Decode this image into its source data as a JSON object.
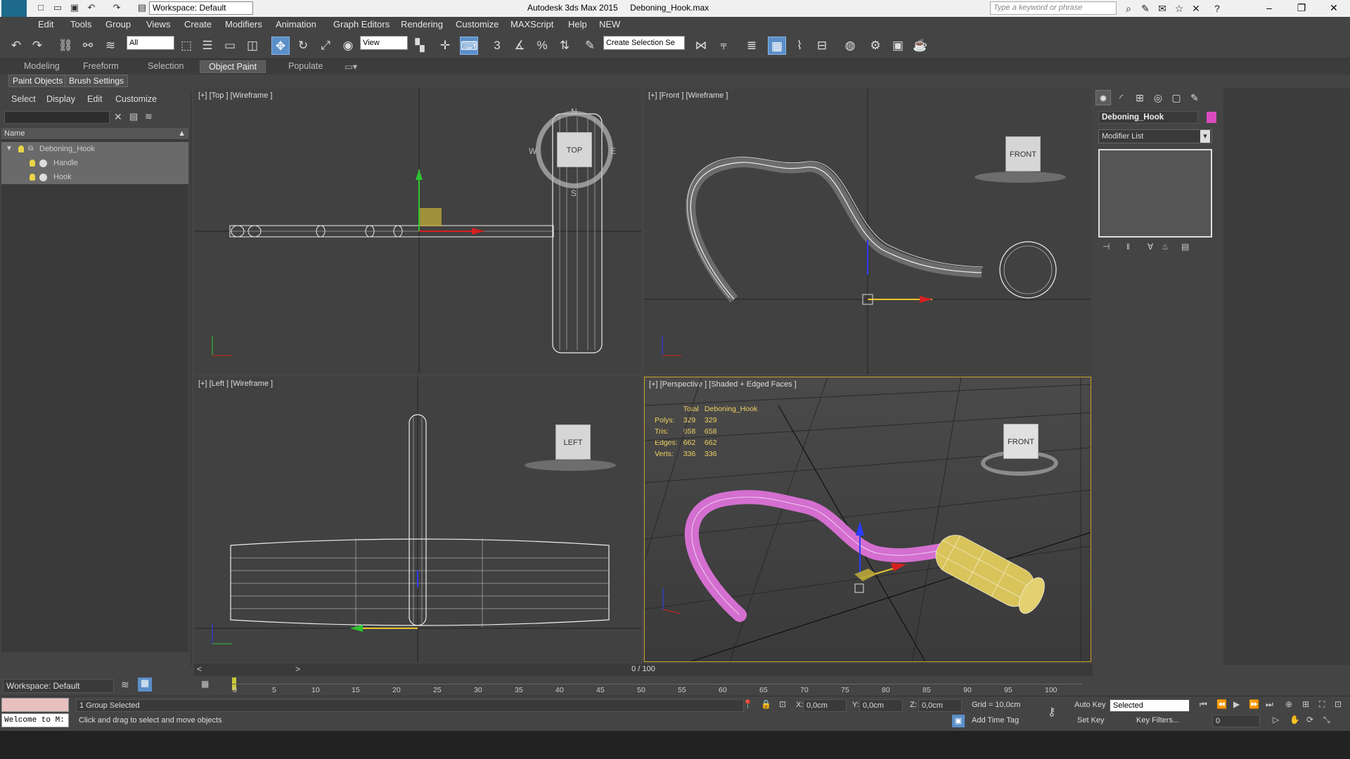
{
  "titlebar": {
    "logo": "MAX",
    "workspace": "Workspace: Default",
    "app_title": "Autodesk 3ds Max 2015",
    "file_name": "Deboning_Hook.max",
    "search_placeholder": "Type a keyword or phrase"
  },
  "menu": [
    "Edit",
    "Tools",
    "Group",
    "Views",
    "Create",
    "Modifiers",
    "Animation",
    "Graph Editors",
    "Rendering",
    "Customize",
    "MAXScript",
    "Help",
    "NEW"
  ],
  "toolbar": {
    "selection_filter": "All",
    "reference_coord": "View",
    "selection_set": "Create Selection Se",
    "snap_angle": "3",
    "snap_percent": "%"
  },
  "ribbon": {
    "tabs": [
      "Modeling",
      "Freeform",
      "Selection",
      "Object Paint",
      "Populate"
    ],
    "active_tab": "Object Paint",
    "sub_buttons": [
      "Paint Objects",
      "Brush Settings"
    ]
  },
  "explorer": {
    "menu": [
      "Select",
      "Display",
      "Edit",
      "Customize"
    ],
    "column_header": "Name",
    "items": [
      {
        "label": "Deboning_Hook",
        "level": 0,
        "type": "group"
      },
      {
        "label": "Handle",
        "level": 1,
        "type": "object"
      },
      {
        "label": "Hook",
        "level": 1,
        "type": "object"
      }
    ],
    "workspace": "Workspace: Default"
  },
  "viewports": {
    "top": {
      "label": "[+] [Top ] [Wireframe ]",
      "cube": "TOP",
      "compass": [
        "N",
        "W",
        "E",
        "S"
      ]
    },
    "front": {
      "label": "[+] [Front ] [Wireframe ]",
      "cube": "FRONT"
    },
    "left": {
      "label": "[+] [Left ] [Wireframe ]",
      "cube": "LEFT"
    },
    "perspective": {
      "label": "[+] [Perspective ] [Shaded + Edged Faces ]",
      "cube": "FRONT"
    }
  },
  "stats": {
    "headers": [
      "",
      "Total",
      "Deboning_Hook"
    ],
    "rows": [
      [
        "Polys:",
        "329",
        "329"
      ],
      [
        "Tris:",
        "658",
        "658"
      ],
      [
        "Edges:",
        "662",
        "662"
      ],
      [
        "Verts:",
        "336",
        "336"
      ]
    ]
  },
  "command_panel": {
    "object_name": "Deboning_Hook",
    "object_color": "#d94bbf",
    "modifier_list": "Modifier List"
  },
  "timeline": {
    "slider_value": "0 / 100",
    "ticks": [
      "0",
      "5",
      "10",
      "15",
      "20",
      "25",
      "30",
      "35",
      "40",
      "45",
      "50",
      "55",
      "60",
      "65",
      "70",
      "75",
      "80",
      "85",
      "90",
      "95",
      "100"
    ]
  },
  "status": {
    "maxscript": "Welcome to M:",
    "selection": "1 Group Selected",
    "prompt": "Click and drag to select and move objects",
    "x_label": "X:",
    "x_value": "0,0cm",
    "y_label": "Y:",
    "y_value": "0,0cm",
    "z_label": "Z:",
    "z_value": "0,0cm",
    "grid": "Grid = 10,0cm",
    "add_time_tag": "Add Time Tag",
    "auto_key": "Auto Key",
    "set_key": "Set Key",
    "key_mode": "Selected",
    "key_filters": "Key Filters...",
    "frame": "0"
  },
  "colors": {
    "hook": "#d46fd0",
    "handle": "#d8c45a",
    "accent": "#5b8fc9",
    "viewport_active": "#c8a12a"
  }
}
